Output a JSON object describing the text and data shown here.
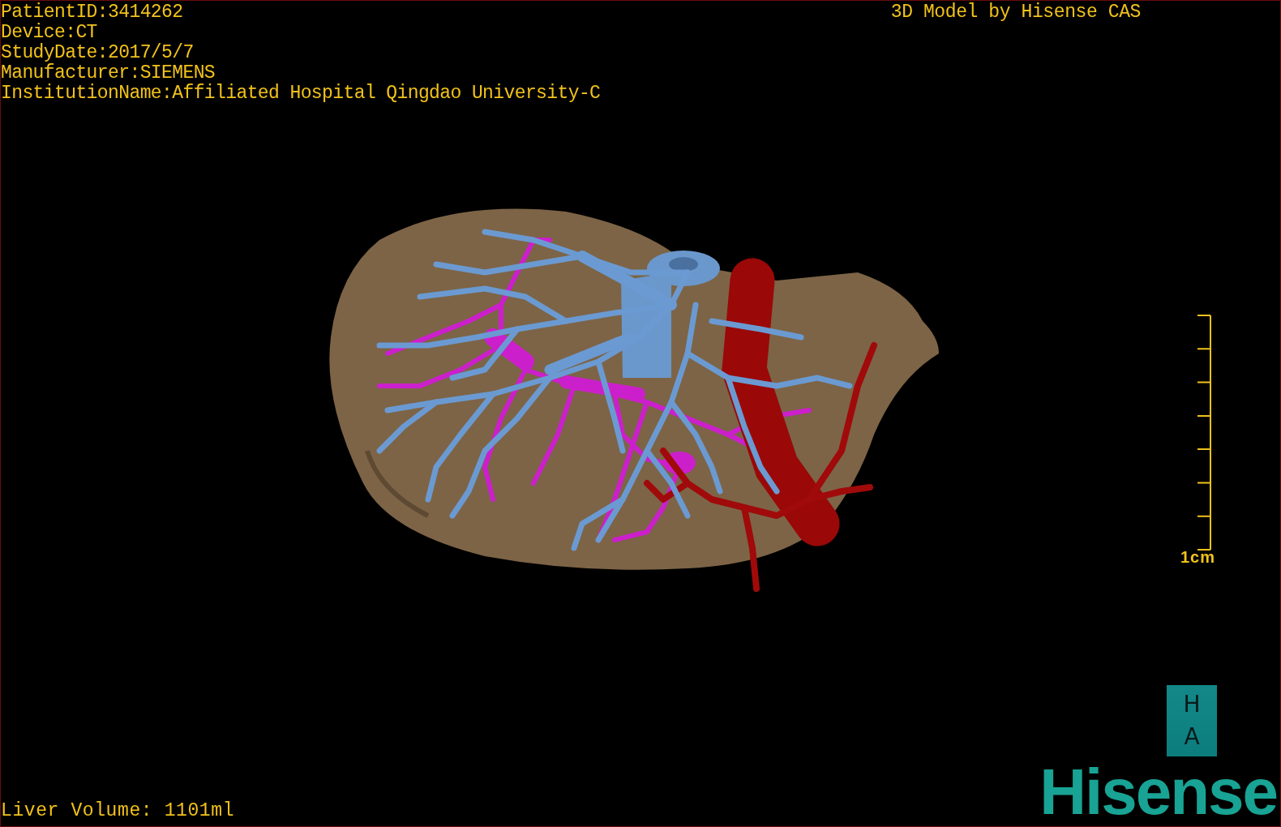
{
  "patient_info": [
    "PatientID:3414262",
    "Device:CT",
    "StudyDate:2017/5/7",
    "Manufacturer:SIEMENS",
    "InstitutionName:Affiliated Hospital Qingdao University-C"
  ],
  "title": "3D Model by Hisense CAS",
  "scale": {
    "label": "1cm"
  },
  "orientation": [
    "H",
    "A"
  ],
  "liver_volume": "Liver Volume: 1101ml",
  "logo": "Hisense"
}
